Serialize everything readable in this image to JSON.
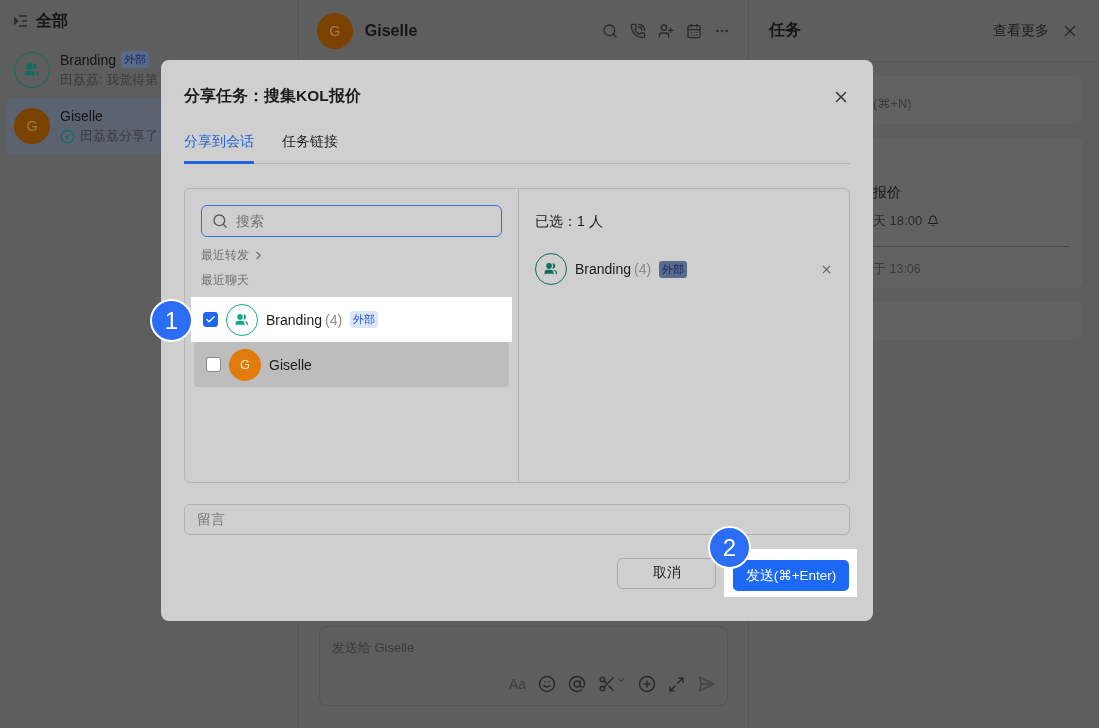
{
  "sidebar": {
    "title": "全部",
    "chats": [
      {
        "name": "Branding",
        "avatar": {
          "kind": "group"
        },
        "tag": "外部",
        "preview": "田荔荔: 我觉得第",
        "done": false,
        "selected": false
      },
      {
        "name": "Giselle",
        "avatar": {
          "kind": "letter",
          "letter": "G"
        },
        "preview": "田荔荔分享了",
        "done": true,
        "selected": true
      }
    ]
  },
  "chat": {
    "name": "Giselle",
    "avatar_letter": "G",
    "input_placeholder": "发送给 Giselle",
    "format_label": "Aa"
  },
  "task_panel": {
    "title": "任务",
    "more": "查看更多",
    "new_hint": "(⌘+N)",
    "task_title": "报价",
    "due": "天 18:00",
    "sent": "于 13:06"
  },
  "dialog": {
    "title": "分享任务：搜集KOL报价",
    "tabs": [
      {
        "label": "分享到会话",
        "selected": true
      },
      {
        "label": "任务链接",
        "selected": false
      }
    ],
    "search_placeholder": "搜索",
    "recent_forward": "最近转发",
    "recent_chats": "最近聊天",
    "contacts": [
      {
        "kind": "group",
        "name": "Branding",
        "count": "(4)",
        "tag": "外部",
        "checked": true,
        "highlighted": true,
        "hovered": false
      },
      {
        "kind": "person",
        "name": "Giselle",
        "letter": "G",
        "checked": false,
        "highlighted": false,
        "hovered": true
      }
    ],
    "selected_label": "已选：1 人",
    "selected": [
      {
        "kind": "group",
        "name": "Branding",
        "count": "(4)",
        "tag": "外部"
      }
    ],
    "message_placeholder": "留言",
    "cancel": "取消",
    "send": {
      "label": "发送(⌘+Enter)",
      "highlighted": true
    }
  },
  "callouts": [
    "1",
    "2"
  ]
}
